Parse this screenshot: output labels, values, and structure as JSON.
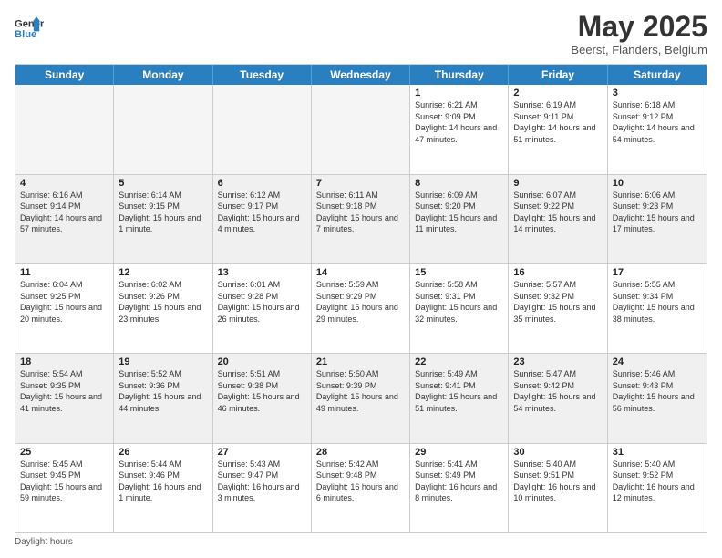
{
  "header": {
    "logo_general": "General",
    "logo_blue": "Blue",
    "month_title": "May 2025",
    "location": "Beerst, Flanders, Belgium"
  },
  "days_of_week": [
    "Sunday",
    "Monday",
    "Tuesday",
    "Wednesday",
    "Thursday",
    "Friday",
    "Saturday"
  ],
  "weeks": [
    {
      "cells": [
        {
          "day": "",
          "empty": true
        },
        {
          "day": "",
          "empty": true
        },
        {
          "day": "",
          "empty": true
        },
        {
          "day": "",
          "empty": true
        },
        {
          "day": "1",
          "sunrise": "Sunrise: 6:21 AM",
          "sunset": "Sunset: 9:09 PM",
          "daylight": "Daylight: 14 hours and 47 minutes."
        },
        {
          "day": "2",
          "sunrise": "Sunrise: 6:19 AM",
          "sunset": "Sunset: 9:11 PM",
          "daylight": "Daylight: 14 hours and 51 minutes."
        },
        {
          "day": "3",
          "sunrise": "Sunrise: 6:18 AM",
          "sunset": "Sunset: 9:12 PM",
          "daylight": "Daylight: 14 hours and 54 minutes."
        }
      ]
    },
    {
      "cells": [
        {
          "day": "4",
          "sunrise": "Sunrise: 6:16 AM",
          "sunset": "Sunset: 9:14 PM",
          "daylight": "Daylight: 14 hours and 57 minutes."
        },
        {
          "day": "5",
          "sunrise": "Sunrise: 6:14 AM",
          "sunset": "Sunset: 9:15 PM",
          "daylight": "Daylight: 15 hours and 1 minute."
        },
        {
          "day": "6",
          "sunrise": "Sunrise: 6:12 AM",
          "sunset": "Sunset: 9:17 PM",
          "daylight": "Daylight: 15 hours and 4 minutes."
        },
        {
          "day": "7",
          "sunrise": "Sunrise: 6:11 AM",
          "sunset": "Sunset: 9:18 PM",
          "daylight": "Daylight: 15 hours and 7 minutes."
        },
        {
          "day": "8",
          "sunrise": "Sunrise: 6:09 AM",
          "sunset": "Sunset: 9:20 PM",
          "daylight": "Daylight: 15 hours and 11 minutes."
        },
        {
          "day": "9",
          "sunrise": "Sunrise: 6:07 AM",
          "sunset": "Sunset: 9:22 PM",
          "daylight": "Daylight: 15 hours and 14 minutes."
        },
        {
          "day": "10",
          "sunrise": "Sunrise: 6:06 AM",
          "sunset": "Sunset: 9:23 PM",
          "daylight": "Daylight: 15 hours and 17 minutes."
        }
      ]
    },
    {
      "cells": [
        {
          "day": "11",
          "sunrise": "Sunrise: 6:04 AM",
          "sunset": "Sunset: 9:25 PM",
          "daylight": "Daylight: 15 hours and 20 minutes."
        },
        {
          "day": "12",
          "sunrise": "Sunrise: 6:02 AM",
          "sunset": "Sunset: 9:26 PM",
          "daylight": "Daylight: 15 hours and 23 minutes."
        },
        {
          "day": "13",
          "sunrise": "Sunrise: 6:01 AM",
          "sunset": "Sunset: 9:28 PM",
          "daylight": "Daylight: 15 hours and 26 minutes."
        },
        {
          "day": "14",
          "sunrise": "Sunrise: 5:59 AM",
          "sunset": "Sunset: 9:29 PM",
          "daylight": "Daylight: 15 hours and 29 minutes."
        },
        {
          "day": "15",
          "sunrise": "Sunrise: 5:58 AM",
          "sunset": "Sunset: 9:31 PM",
          "daylight": "Daylight: 15 hours and 32 minutes."
        },
        {
          "day": "16",
          "sunrise": "Sunrise: 5:57 AM",
          "sunset": "Sunset: 9:32 PM",
          "daylight": "Daylight: 15 hours and 35 minutes."
        },
        {
          "day": "17",
          "sunrise": "Sunrise: 5:55 AM",
          "sunset": "Sunset: 9:34 PM",
          "daylight": "Daylight: 15 hours and 38 minutes."
        }
      ]
    },
    {
      "cells": [
        {
          "day": "18",
          "sunrise": "Sunrise: 5:54 AM",
          "sunset": "Sunset: 9:35 PM",
          "daylight": "Daylight: 15 hours and 41 minutes."
        },
        {
          "day": "19",
          "sunrise": "Sunrise: 5:52 AM",
          "sunset": "Sunset: 9:36 PM",
          "daylight": "Daylight: 15 hours and 44 minutes."
        },
        {
          "day": "20",
          "sunrise": "Sunrise: 5:51 AM",
          "sunset": "Sunset: 9:38 PM",
          "daylight": "Daylight: 15 hours and 46 minutes."
        },
        {
          "day": "21",
          "sunrise": "Sunrise: 5:50 AM",
          "sunset": "Sunset: 9:39 PM",
          "daylight": "Daylight: 15 hours and 49 minutes."
        },
        {
          "day": "22",
          "sunrise": "Sunrise: 5:49 AM",
          "sunset": "Sunset: 9:41 PM",
          "daylight": "Daylight: 15 hours and 51 minutes."
        },
        {
          "day": "23",
          "sunrise": "Sunrise: 5:47 AM",
          "sunset": "Sunset: 9:42 PM",
          "daylight": "Daylight: 15 hours and 54 minutes."
        },
        {
          "day": "24",
          "sunrise": "Sunrise: 5:46 AM",
          "sunset": "Sunset: 9:43 PM",
          "daylight": "Daylight: 15 hours and 56 minutes."
        }
      ]
    },
    {
      "cells": [
        {
          "day": "25",
          "sunrise": "Sunrise: 5:45 AM",
          "sunset": "Sunset: 9:45 PM",
          "daylight": "Daylight: 15 hours and 59 minutes."
        },
        {
          "day": "26",
          "sunrise": "Sunrise: 5:44 AM",
          "sunset": "Sunset: 9:46 PM",
          "daylight": "Daylight: 16 hours and 1 minute."
        },
        {
          "day": "27",
          "sunrise": "Sunrise: 5:43 AM",
          "sunset": "Sunset: 9:47 PM",
          "daylight": "Daylight: 16 hours and 3 minutes."
        },
        {
          "day": "28",
          "sunrise": "Sunrise: 5:42 AM",
          "sunset": "Sunset: 9:48 PM",
          "daylight": "Daylight: 16 hours and 6 minutes."
        },
        {
          "day": "29",
          "sunrise": "Sunrise: 5:41 AM",
          "sunset": "Sunset: 9:49 PM",
          "daylight": "Daylight: 16 hours and 8 minutes."
        },
        {
          "day": "30",
          "sunrise": "Sunrise: 5:40 AM",
          "sunset": "Sunset: 9:51 PM",
          "daylight": "Daylight: 16 hours and 10 minutes."
        },
        {
          "day": "31",
          "sunrise": "Sunrise: 5:40 AM",
          "sunset": "Sunset: 9:52 PM",
          "daylight": "Daylight: 16 hours and 12 minutes."
        }
      ]
    }
  ],
  "footer": {
    "note": "Daylight hours"
  }
}
